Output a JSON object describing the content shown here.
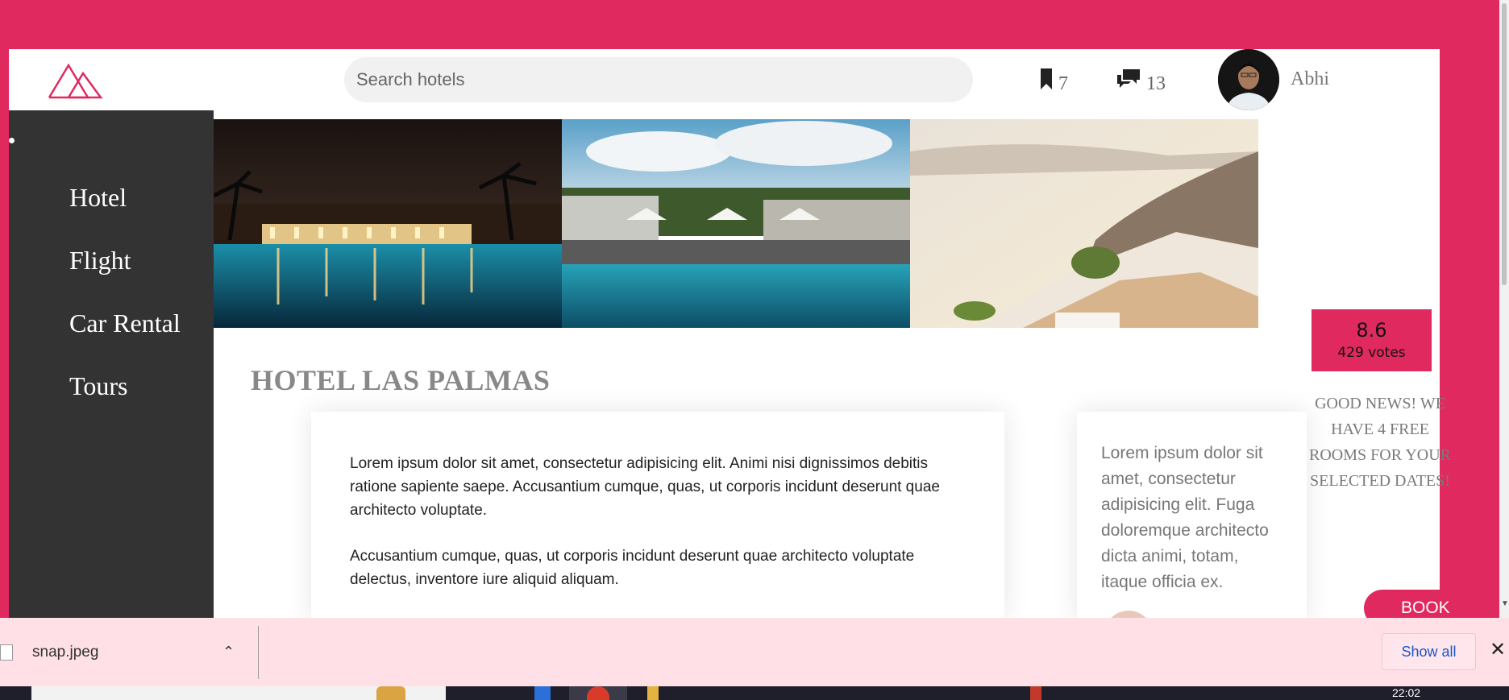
{
  "header": {
    "search_placeholder": "Search hotels",
    "bookmark_count": "7",
    "comment_count": "13",
    "user_name": "Abhi"
  },
  "sidebar": {
    "items": [
      {
        "label": "Hotel"
      },
      {
        "label": "Flight"
      },
      {
        "label": "Car Rental"
      },
      {
        "label": "Tours"
      }
    ]
  },
  "hotel": {
    "title": "HOTEL LAS PALMAS",
    "description": [
      "Lorem ipsum dolor sit amet, consectetur adipisicing elit. Animi nisi dignissimos debitis ratione sapiente saepe. Accusantium cumque, quas, ut corporis incidunt deserunt quae architecto voluptate.",
      "Accusantium cumque, quas, ut corporis incidunt deserunt quae architecto voluptate delectus, inventore iure aliquid aliquam."
    ],
    "side_text": "Lorem ipsum dolor sit amet, consectetur adipisicing elit. Fuga doloremque architecto dicta animi, totam, itaque officia ex.",
    "rating": "8.6",
    "votes": "429 votes",
    "good_news": "GOOD NEWS! WE HAVE 4 FREE ROOMS FOR YOUR SELECTED DATES!",
    "book_label": "BOOK"
  },
  "download_bar": {
    "file_name": "snap.jpeg",
    "show_all_label": "Show all"
  },
  "taskbar": {
    "time": "22:02"
  },
  "colors": {
    "accent": "#e0295f",
    "sidebar": "#333333",
    "download_bar": "#ffe0e6"
  }
}
